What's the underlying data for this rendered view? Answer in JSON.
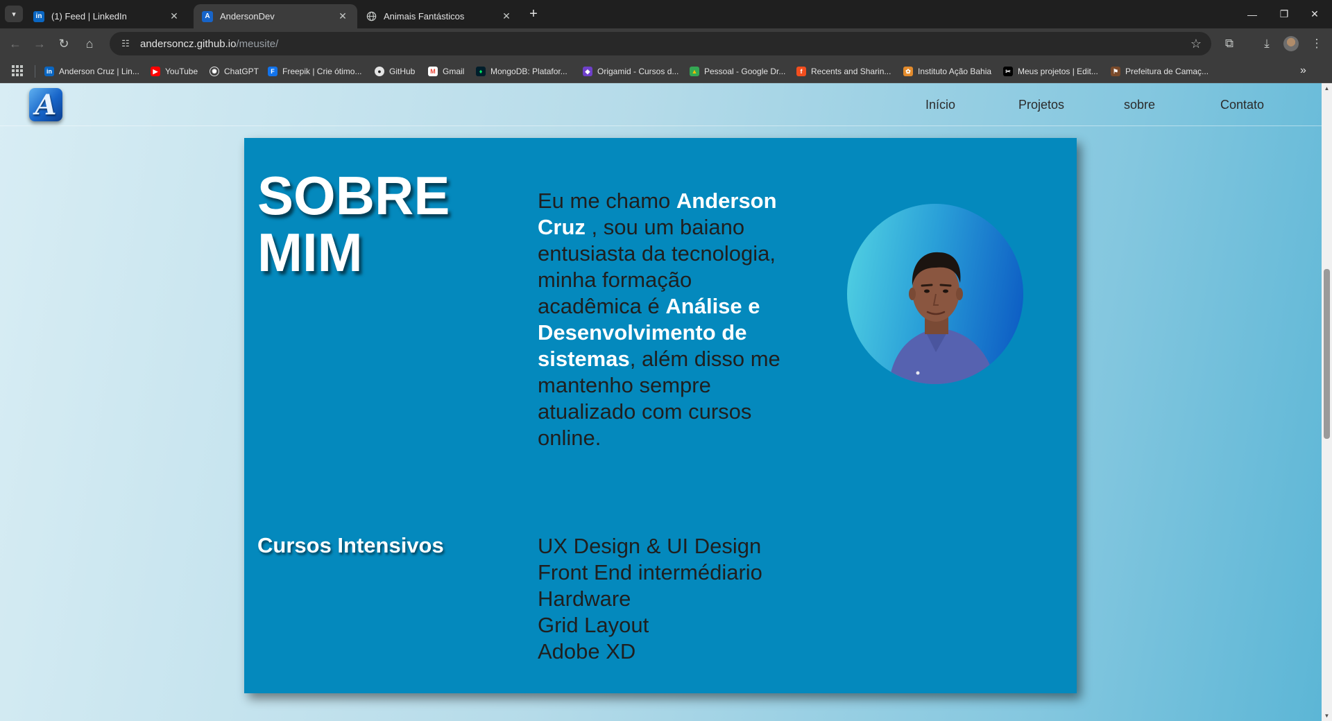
{
  "browser": {
    "tabs": [
      {
        "title": "(1) Feed | LinkedIn",
        "icon": "linkedin-icon"
      },
      {
        "title": "AndersonDev",
        "icon": "site-logo-icon"
      },
      {
        "title": "Animais Fantásticos",
        "icon": "globe-icon"
      }
    ],
    "url_host": "andersoncz.github.io",
    "url_path": "/meusite/",
    "bookmarks": [
      {
        "label": "Anderson Cruz | Lin...",
        "icon": "linkedin-icon"
      },
      {
        "label": "YouTube",
        "icon": "youtube-icon"
      },
      {
        "label": "ChatGPT",
        "icon": "chatgpt-icon"
      },
      {
        "label": "Freepik | Crie ótimo...",
        "icon": "freepik-icon"
      },
      {
        "label": "GitHub",
        "icon": "github-icon"
      },
      {
        "label": "Gmail",
        "icon": "gmail-icon"
      },
      {
        "label": "MongoDB: Platafor...",
        "icon": "mongodb-icon"
      },
      {
        "label": "Origamid - Cursos d...",
        "icon": "origamid-icon"
      },
      {
        "label": "Pessoal - Google Dr...",
        "icon": "google-drive-icon"
      },
      {
        "label": "Recents and Sharin...",
        "icon": "figma-icon"
      },
      {
        "label": "Instituto Ação Bahia",
        "icon": "instituto-icon"
      },
      {
        "label": "Meus projetos | Edit...",
        "icon": "capcut-icon"
      },
      {
        "label": "Prefeitura de Camaç...",
        "icon": "prefeitura-icon"
      }
    ]
  },
  "site": {
    "logo_letter": "A",
    "nav": [
      "Início",
      "Projetos",
      "sobre",
      "Contato"
    ]
  },
  "about": {
    "title": "SOBRE MIM",
    "text": {
      "p1": "Eu me chamo ",
      "name": "Anderson Cruz",
      "p2": " , sou um baiano entusiasta da tecnologia, minha formação acadêmica é ",
      "degree": "Análise e Desenvolvimento de sistemas",
      "p3": ", além disso me mantenho sempre atualizado com cursos online."
    },
    "courses_title": "Cursos Intensivos",
    "courses": [
      "UX Design & UI Design",
      "Front End intermédiario",
      "Hardware",
      "Grid Layout",
      "Adobe XD"
    ]
  },
  "colors": {
    "card": "#0489bd",
    "chrome_dark": "#1f1f1f",
    "chrome_toolbar": "#3c3c3c"
  }
}
